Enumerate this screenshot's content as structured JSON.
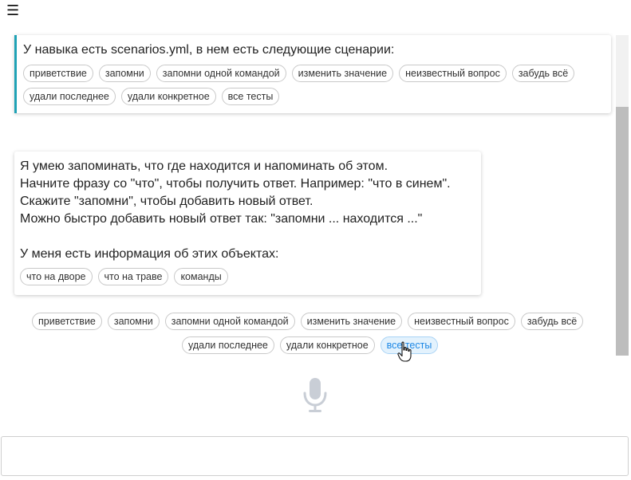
{
  "menu": {
    "icon": "hamburger-menu-icon",
    "glyph": "☰"
  },
  "skill_card": {
    "text": "У навыка есть scenarios.yml, в нем есть следующие сценарии:",
    "accent_color": "#1fa2b5",
    "chips": [
      "приветствие",
      "запомни",
      "запомни одной командой",
      "изменить значение",
      "неизвестный вопрос",
      "забудь всё",
      "удали последнее",
      "удали конкретное",
      "все тесты"
    ]
  },
  "answer_card": {
    "text": "Я умею запоминать, что где находится и напоминать об этом.\nНачните фразу со \"что\", чтобы получить ответ. Например: \"что в синем\".\nСкажите \"запомни\", чтобы добавить новый ответ.\nМожно быстро добавить новый ответ так: \"запомни ... находится ...\"\n\nУ меня есть информация об этих объектах:",
    "chips": [
      "что на дворе",
      "что на траве",
      "команды"
    ]
  },
  "suggestions": {
    "row1": [
      "приветствие",
      "запомни",
      "запомни одной командой",
      "изменить значение",
      "неизвестный вопрос",
      "забудь всё"
    ],
    "row2": [
      "удали последнее",
      "удали конкретное",
      "все тесты"
    ],
    "active": "все тесты",
    "active_color": "#1e88e5"
  },
  "mic": {
    "icon": "microphone-icon",
    "color": "#c9ced6"
  },
  "input": {
    "value": "",
    "placeholder": ""
  }
}
